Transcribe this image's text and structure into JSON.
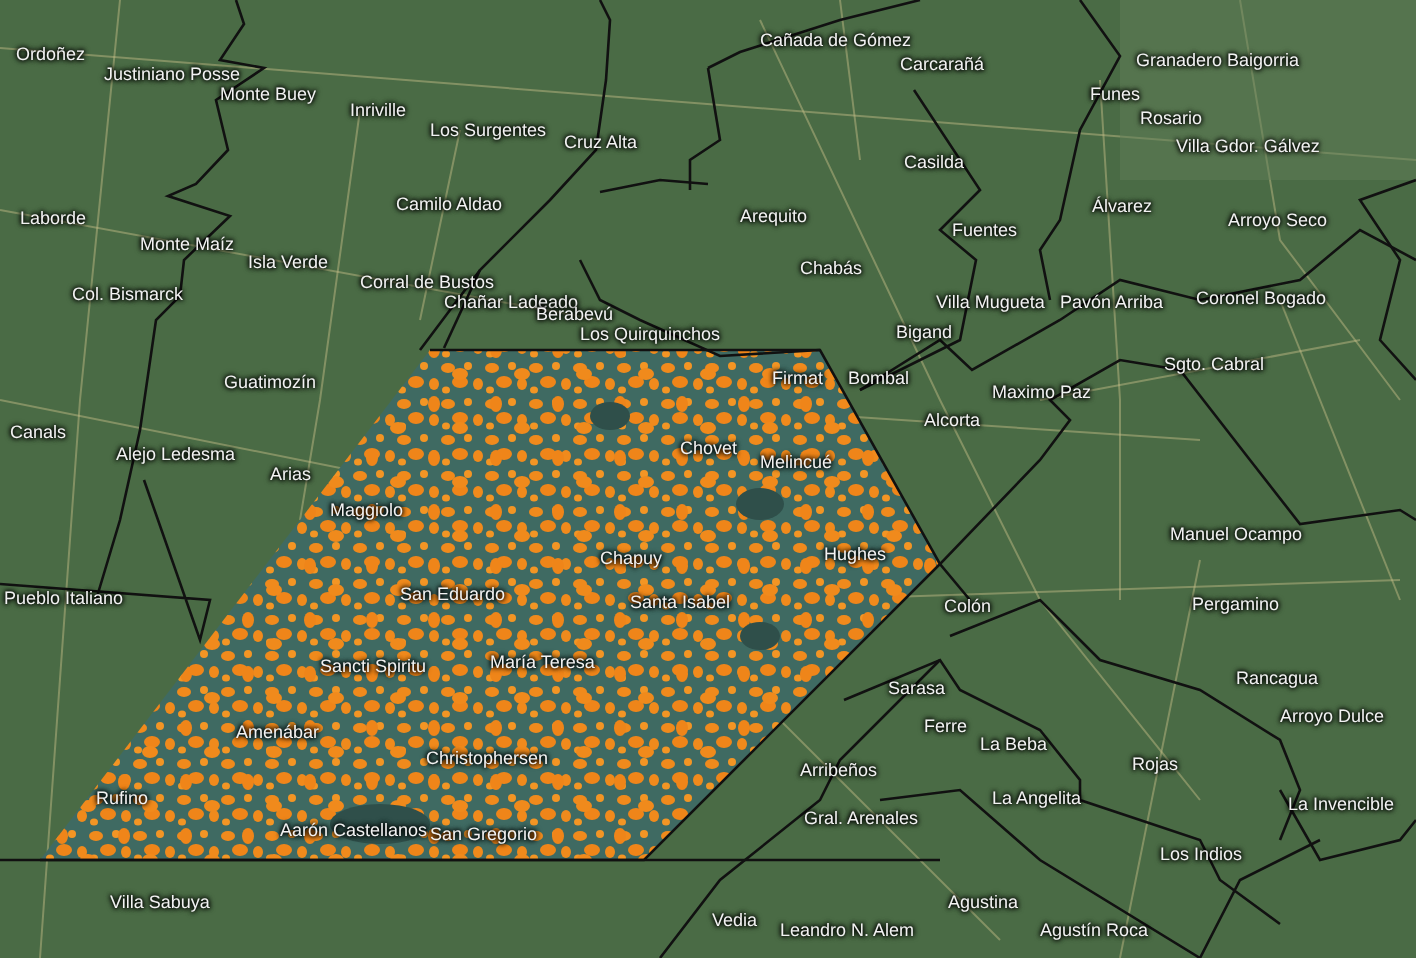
{
  "map": {
    "labels": [
      {
        "text": "Ordoñez"
      },
      {
        "text": "Justiniano Posse"
      },
      {
        "text": "Monte Buey"
      },
      {
        "text": "Inriville"
      },
      {
        "text": "Los Surgentes"
      },
      {
        "text": "Cruz Alta"
      },
      {
        "text": "Camilo Aldao"
      },
      {
        "text": "Laborde"
      },
      {
        "text": "Monte Maíz"
      },
      {
        "text": "Isla Verde"
      },
      {
        "text": "Corral de Bustos"
      },
      {
        "text": "Chañar Ladeado"
      },
      {
        "text": "Berabevú"
      },
      {
        "text": "Los Quirquinchos"
      },
      {
        "text": "Col. Bismarck"
      },
      {
        "text": "Guatimozín"
      },
      {
        "text": "Canals"
      },
      {
        "text": "Alejo Ledesma"
      },
      {
        "text": "Arias"
      },
      {
        "text": "Cañada de Gómez"
      },
      {
        "text": "Carcarañá"
      },
      {
        "text": "Granadero Baigorria"
      },
      {
        "text": "Funes"
      },
      {
        "text": "Rosario"
      },
      {
        "text": "Villa Gdor. Gálvez"
      },
      {
        "text": "Casilda"
      },
      {
        "text": "Arequito"
      },
      {
        "text": "Fuentes"
      },
      {
        "text": "Álvarez"
      },
      {
        "text": "Arroyo Seco"
      },
      {
        "text": "Chabás"
      },
      {
        "text": "Villa Mugueta"
      },
      {
        "text": "Pavón Arriba"
      },
      {
        "text": "Coronel Bogado"
      },
      {
        "text": "Bigand"
      },
      {
        "text": "Bombal"
      },
      {
        "text": "Sgto. Cabral"
      },
      {
        "text": "Maximo Paz"
      },
      {
        "text": "Alcorta"
      },
      {
        "text": "Firmat"
      },
      {
        "text": "Chovet"
      },
      {
        "text": "Melincué"
      },
      {
        "text": "Maggiolo"
      },
      {
        "text": "Chapuy"
      },
      {
        "text": "San Eduardo"
      },
      {
        "text": "Santa Isabel"
      },
      {
        "text": "Sancti Spiritu"
      },
      {
        "text": "María Teresa"
      },
      {
        "text": "Amenábar"
      },
      {
        "text": "Christophersen"
      },
      {
        "text": "Rufino"
      },
      {
        "text": "Aarón Castellanos"
      },
      {
        "text": "San Gregorio"
      },
      {
        "text": "Hughes"
      },
      {
        "text": "Pueblo Italiano"
      },
      {
        "text": "Villa Sabuya"
      },
      {
        "text": "Manuel Ocampo"
      },
      {
        "text": "Colón"
      },
      {
        "text": "Pergamino"
      },
      {
        "text": "Sarasa"
      },
      {
        "text": "Rancagua"
      },
      {
        "text": "Ferre"
      },
      {
        "text": "La Beba"
      },
      {
        "text": "Arroyo Dulce"
      },
      {
        "text": "Arribeños"
      },
      {
        "text": "Rojas"
      },
      {
        "text": "La Angelita"
      },
      {
        "text": "Gral. Arenales"
      },
      {
        "text": "La Invencible"
      },
      {
        "text": "Los Indios"
      },
      {
        "text": "Agustina"
      },
      {
        "text": "Vedia"
      },
      {
        "text": "Leandro N. Alem"
      },
      {
        "text": "Agustín Roca"
      }
    ]
  }
}
